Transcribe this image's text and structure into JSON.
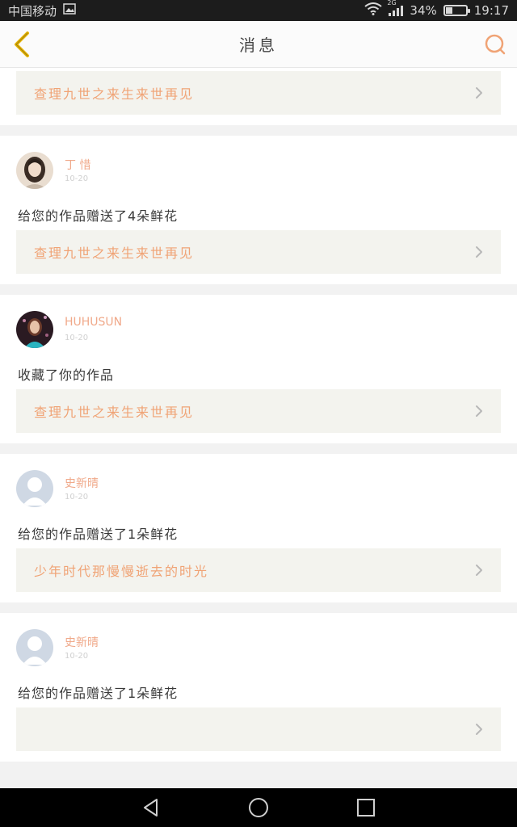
{
  "status_bar": {
    "carrier": "中国移动",
    "network": "2G",
    "battery": "34%",
    "battery_level": 0.34,
    "time": "19:17"
  },
  "header": {
    "title": "消息"
  },
  "colors": {
    "accent": "#f0a375",
    "name": "#f0a98a",
    "back_arrow": "#e6b400"
  },
  "messages": [
    {
      "user": "丁 惜",
      "time": "10-20",
      "text": "给您的作品赠送了4朵鲜花",
      "work": "查理九世之来生来世再见",
      "avatar": "girl-photo-avatar"
    },
    {
      "user": "丁 惜",
      "time": "10-20",
      "text": "给您的作品赠送了4朵鲜花",
      "work": "查理九世之来生来世再见",
      "avatar": "girl-photo-avatar"
    },
    {
      "user": "HUHUSUN",
      "time": "10-20",
      "text": "收藏了你的作品",
      "work": "查理九世之来生来世再见",
      "avatar": "girl-photo-avatar-dark"
    },
    {
      "user": "史新晴",
      "time": "10-20",
      "text": "给您的作品赠送了1朵鲜花",
      "work": "少年时代那慢慢逝去的时光",
      "avatar": "default-avatar"
    },
    {
      "user": "史新晴",
      "time": "10-20",
      "text": "给您的作品赠送了1朵鲜花",
      "work": "",
      "avatar": "default-avatar"
    }
  ]
}
